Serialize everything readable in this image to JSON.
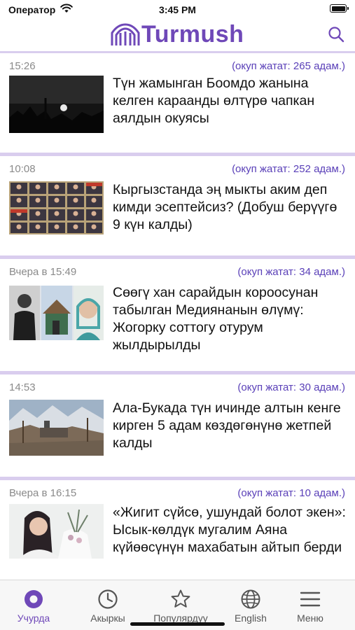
{
  "status_bar": {
    "carrier": "Оператор",
    "time": "3:45 PM"
  },
  "header": {
    "logo_text": "Turmush",
    "search_icon": "search-icon",
    "accent_color": "#6f48b8"
  },
  "feed": [
    {
      "time": "15:26",
      "readers": "(окуп жатат: 265 адам.)",
      "title": "Түн жамынган Боомдо жанына келген караанды өлтүрө чапкан аялдын окуясы",
      "image": "night-moon-photo"
    },
    {
      "time": "10:08",
      "readers": "(окуп жатат: 252 адам.)",
      "title": "Кыргызстанда эң мыкты аким деп кимди эсептейсиз?  (Добуш берүүгө 9 күн калды)",
      "image": "portrait-grid-photo"
    },
    {
      "time": "Вчера в 15:49",
      "readers": "(окуп жатат: 34 адам.)",
      "title": "Сөөгү хан сарайдын короосунан табылган Медиянанын өлүмү: Жогорку соттогу отурум жылдырылды",
      "image": "collage-photo"
    },
    {
      "time": "14:53",
      "readers": "(окуп жатат: 30 адам.)",
      "title": "Ала-Букада түн ичинде алтын кенге кирген 5 адам көздөгөнүнө жетпей калды",
      "image": "snowy-mine-photo"
    },
    {
      "time": "Вчера в 16:15",
      "readers": "(окуп жатат: 10 адам.)",
      "title": "«Жигит сүйсө, ушундай болот экен»: Ысык-көлдүк мугалим Аяна күйөөсүнүн махабатын айтып берди",
      "image": "woman-bouquet-photo"
    }
  ],
  "tab_bar": {
    "tabs": [
      {
        "label": "Учурда",
        "icon": "circle-icon",
        "active": true
      },
      {
        "label": "Акыркы",
        "icon": "clock-icon",
        "active": false
      },
      {
        "label": "Популярдуу",
        "icon": "star-icon",
        "active": false
      },
      {
        "label": "English",
        "icon": "globe-icon",
        "active": false
      },
      {
        "label": "Меню",
        "icon": "menu-icon",
        "active": false
      }
    ]
  }
}
